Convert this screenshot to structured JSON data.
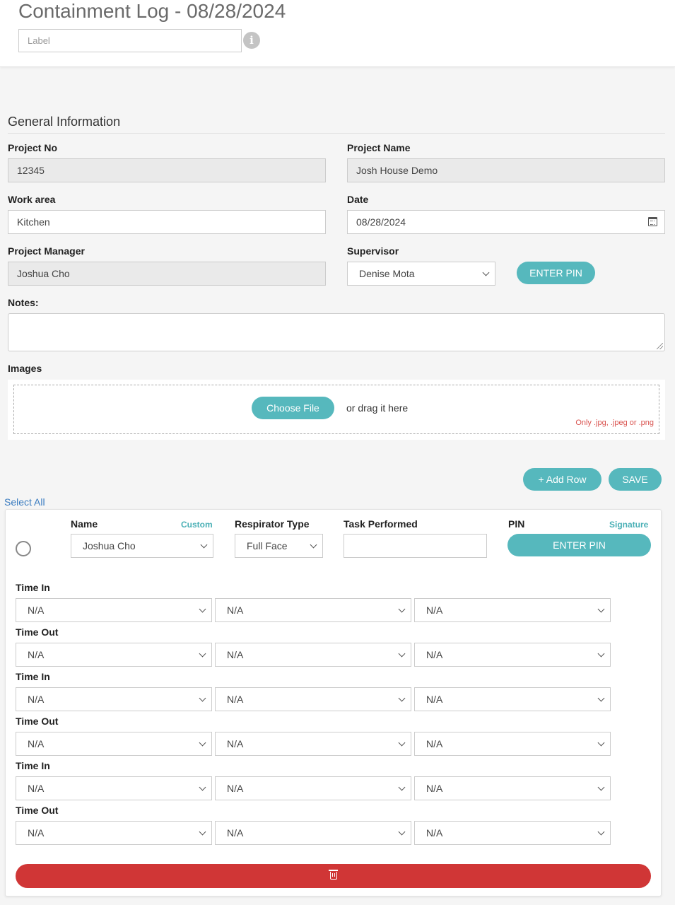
{
  "header": {
    "title": "Containment Log - 08/28/2024",
    "label_placeholder": "Label",
    "info_icon": "info-icon"
  },
  "general": {
    "section_title": "General Information",
    "project_no": {
      "label": "Project No",
      "value": "12345"
    },
    "project_name": {
      "label": "Project Name",
      "value": "Josh House Demo"
    },
    "work_area": {
      "label": "Work area",
      "value": "Kitchen"
    },
    "date": {
      "label": "Date",
      "value": "08/28/2024",
      "icon": "calendar-icon"
    },
    "project_manager": {
      "label": "Project Manager",
      "value": "Joshua Cho"
    },
    "supervisor": {
      "label": "Supervisor",
      "value": "Denise Mota",
      "pin_button": "ENTER PIN"
    },
    "notes": {
      "label": "Notes:",
      "value": ""
    }
  },
  "images": {
    "label": "Images",
    "choose_file": "Choose File",
    "drag_text": "or drag it here",
    "allowed_text": "Only .jpg, .jpeg or .png"
  },
  "actions": {
    "add_row": "+ Add Row",
    "save": "SAVE"
  },
  "table": {
    "select_all": "Select All",
    "columns": {
      "name": "Name",
      "custom_link": "Custom",
      "respirator": "Respirator Type",
      "task": "Task Performed",
      "pin": "PIN",
      "signature_link": "Signature"
    },
    "row": {
      "name": "Joshua Cho",
      "respirator": "Full Face",
      "task": "",
      "pin_button": "ENTER PIN",
      "times": [
        {
          "label": "Time In",
          "values": [
            "N/A",
            "N/A",
            "N/A"
          ]
        },
        {
          "label": "Time Out",
          "values": [
            "N/A",
            "N/A",
            "N/A"
          ]
        },
        {
          "label": "Time In",
          "values": [
            "N/A",
            "N/A",
            "N/A"
          ]
        },
        {
          "label": "Time Out",
          "values": [
            "N/A",
            "N/A",
            "N/A"
          ]
        },
        {
          "label": "Time In",
          "values": [
            "N/A",
            "N/A",
            "N/A"
          ]
        },
        {
          "label": "Time Out",
          "values": [
            "N/A",
            "N/A",
            "N/A"
          ]
        }
      ],
      "delete_icon": "trash-icon"
    }
  },
  "colors": {
    "accent": "#56b8bd",
    "danger": "#d03636",
    "link": "#3a7cc0"
  }
}
